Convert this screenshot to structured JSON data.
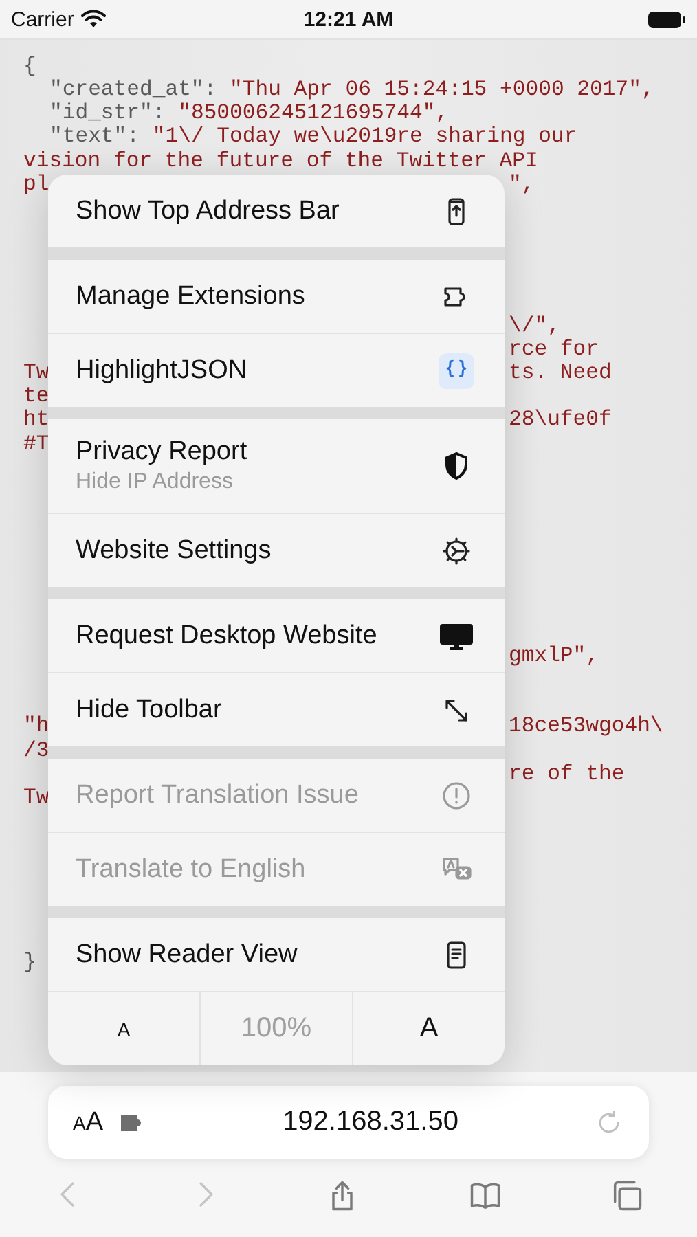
{
  "status_bar": {
    "carrier": "Carrier",
    "time": "12:21 AM"
  },
  "code_lines": [
    {
      "kind": "punct",
      "text": "{"
    },
    {
      "kind": "pair",
      "key": "\"created_at\":",
      "value": "\"Thu Apr 06 15:24:15 +0000 2017\","
    },
    {
      "kind": "pair",
      "key": "\"id_str\":",
      "value": "\"850006245121695744\","
    },
    {
      "kind": "pair",
      "key": "\"text\":",
      "value": "\"1\\/ Today we\\u2019re sharing our"
    },
    {
      "kind": "string",
      "text": "vision for the future of the Twitter API"
    },
    {
      "kind": "split",
      "left": "pl",
      "right": "\","
    },
    {
      "kind": "blank"
    },
    {
      "kind": "blank"
    },
    {
      "kind": "blank"
    },
    {
      "kind": "blank"
    },
    {
      "kind": "blank"
    },
    {
      "kind": "split",
      "right": "\\/\","
    },
    {
      "kind": "split",
      "right": "rce for"
    },
    {
      "kind": "split",
      "left": "Tw",
      "right": "ts. Need"
    },
    {
      "kind": "split",
      "left": "te"
    },
    {
      "kind": "split",
      "left": "ht",
      "right": "28\\ufe0f"
    },
    {
      "kind": "split",
      "left": "#T"
    },
    {
      "kind": "blank"
    },
    {
      "kind": "blank"
    },
    {
      "kind": "blank"
    },
    {
      "kind": "blank"
    },
    {
      "kind": "blank"
    },
    {
      "kind": "blank"
    },
    {
      "kind": "blank"
    },
    {
      "kind": "blank"
    },
    {
      "kind": "split",
      "right": "gmxlP\","
    },
    {
      "kind": "blank"
    },
    {
      "kind": "blank"
    },
    {
      "kind": "split",
      "left": "\"h",
      "right": "18ce53wgo4h\\"
    },
    {
      "kind": "split",
      "left": "/3"
    },
    {
      "kind": "split",
      "right": "re of the"
    },
    {
      "kind": "split",
      "left": "Tw"
    },
    {
      "kind": "blank"
    },
    {
      "kind": "blank"
    },
    {
      "kind": "blank"
    },
    {
      "kind": "blank"
    },
    {
      "kind": "blank"
    },
    {
      "kind": "blank"
    },
    {
      "kind": "punct",
      "text": "}"
    }
  ],
  "menu": {
    "groups": [
      {
        "items": [
          {
            "label": "Show Top Address Bar",
            "disabled": false
          }
        ]
      },
      {
        "items": [
          {
            "label": "Manage Extensions",
            "disabled": false
          },
          {
            "label": "HighlightJSON",
            "disabled": false
          }
        ]
      },
      {
        "items": [
          {
            "label": "Privacy Report",
            "subtitle": "Hide IP Address",
            "disabled": false
          },
          {
            "label": "Website Settings",
            "disabled": false
          }
        ]
      },
      {
        "items": [
          {
            "label": "Request Desktop Website",
            "disabled": false
          },
          {
            "label": "Hide Toolbar",
            "disabled": false
          }
        ]
      },
      {
        "items": [
          {
            "label": "Report Translation Issue",
            "disabled": true
          },
          {
            "label": "Translate to English",
            "disabled": true
          }
        ]
      },
      {
        "items": [
          {
            "label": "Show Reader View",
            "disabled": false
          }
        ]
      }
    ],
    "font_size": {
      "decrease": "A",
      "zoom": "100%",
      "increase": "A"
    }
  },
  "address_bar": {
    "format_small": "A",
    "format_large": "A",
    "url": "192.168.31.50"
  },
  "toolbar": [
    {
      "disabled": true
    },
    {
      "disabled": true
    },
    {
      "disabled": false
    },
    {
      "disabled": false
    },
    {
      "disabled": false
    }
  ]
}
